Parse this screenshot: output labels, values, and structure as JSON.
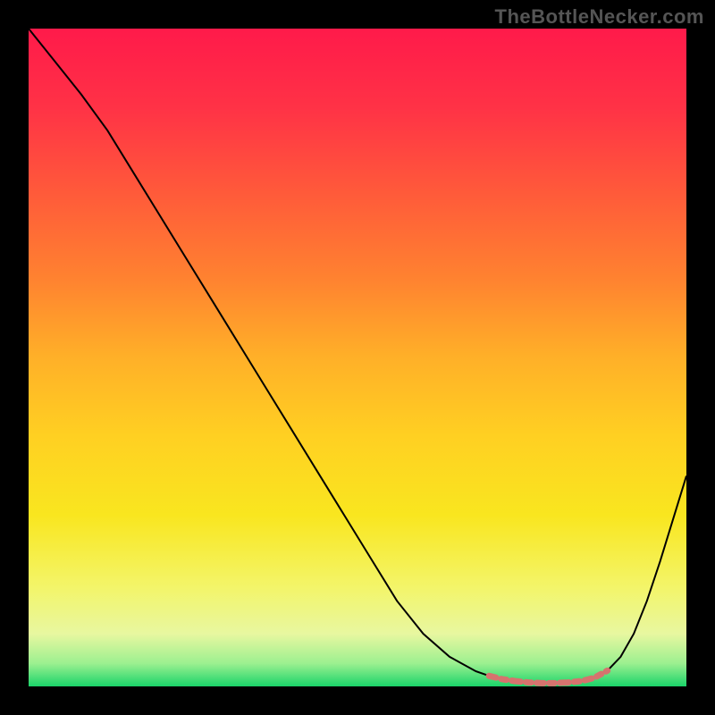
{
  "watermark": "TheBottleNecker.com",
  "chart_data": {
    "type": "line",
    "title": "",
    "xlabel": "",
    "ylabel": "",
    "xlim": [
      0,
      100
    ],
    "ylim": [
      0,
      100
    ],
    "background_gradient": {
      "stops": [
        {
          "offset": 0.0,
          "color": "#ff1a4a"
        },
        {
          "offset": 0.12,
          "color": "#ff3246"
        },
        {
          "offset": 0.25,
          "color": "#ff5a3a"
        },
        {
          "offset": 0.38,
          "color": "#ff8230"
        },
        {
          "offset": 0.5,
          "color": "#ffb028"
        },
        {
          "offset": 0.62,
          "color": "#ffd022"
        },
        {
          "offset": 0.74,
          "color": "#f9e61f"
        },
        {
          "offset": 0.85,
          "color": "#f3f56a"
        },
        {
          "offset": 0.92,
          "color": "#e8f7a0"
        },
        {
          "offset": 0.965,
          "color": "#9cf090"
        },
        {
          "offset": 1.0,
          "color": "#1bd46a"
        }
      ]
    },
    "series": [
      {
        "name": "main-curve",
        "stroke": "#000000",
        "stroke_width": 2,
        "x": [
          0,
          4,
          8,
          12,
          16,
          20,
          24,
          28,
          32,
          36,
          40,
          44,
          48,
          52,
          56,
          60,
          64,
          68,
          70,
          72,
          74,
          76,
          78,
          80,
          82,
          84,
          86,
          88,
          90,
          92,
          94,
          96,
          98,
          100
        ],
        "y": [
          100,
          95,
          90,
          84.5,
          78,
          71.5,
          65,
          58.5,
          52,
          45.5,
          39,
          32.5,
          26,
          19.5,
          13,
          8,
          4.5,
          2.3,
          1.6,
          1.1,
          0.8,
          0.6,
          0.5,
          0.5,
          0.6,
          0.8,
          1.3,
          2.4,
          4.5,
          8,
          13,
          19,
          25.5,
          32
        ]
      },
      {
        "name": "highlight-band",
        "stroke": "#d6736e",
        "stroke_width": 7,
        "linecap": "round",
        "dash": "8 6 6 6 10 6 6 6",
        "x": [
          70,
          72,
          74,
          76,
          78,
          80,
          82,
          84,
          86,
          88
        ],
        "y": [
          1.6,
          1.1,
          0.8,
          0.6,
          0.5,
          0.5,
          0.6,
          0.8,
          1.3,
          2.4
        ]
      }
    ]
  }
}
